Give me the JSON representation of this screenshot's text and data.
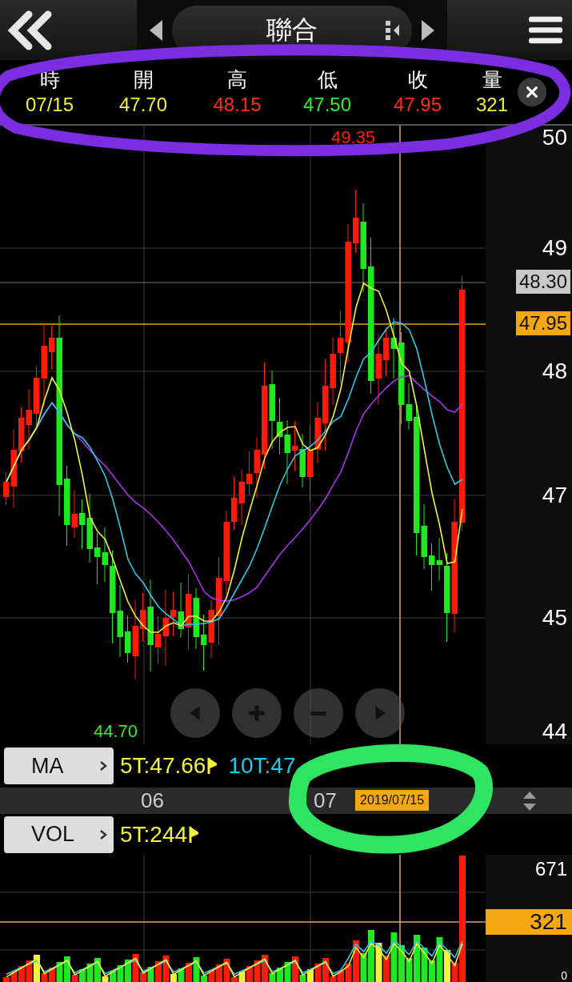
{
  "title": "聯合",
  "quote": [
    {
      "label": "時",
      "value": "07/15",
      "color": "#f2f23a"
    },
    {
      "label": "開",
      "value": "47.70",
      "color": "#f2f23a"
    },
    {
      "label": "高",
      "value": "48.15",
      "color": "#ff2a1a"
    },
    {
      "label": "低",
      "value": "47.50",
      "color": "#2bf02b"
    },
    {
      "label": "收",
      "value": "47.95",
      "color": "#ff2a1a"
    },
    {
      "label": "量",
      "value": "321",
      "color": "#f2f23a"
    }
  ],
  "price_axis": [
    "50",
    "49",
    "48",
    "47",
    "45",
    "44"
  ],
  "price_tags": [
    {
      "text": "48.30",
      "kind": "reference"
    },
    {
      "text": "47.95",
      "kind": "current"
    }
  ],
  "high_mark": "49.35",
  "low_mark": "44.70",
  "ma": {
    "button": "MA",
    "legend": [
      {
        "text": "5T:47.66",
        "color": "#f2f23a",
        "kind": "flagged"
      },
      {
        "text": "10T:47",
        "color": "#22c8e8",
        "kind": "plain"
      }
    ]
  },
  "date_axis": {
    "labels": [
      "06",
      "07"
    ],
    "cursor_date": "2019/07/15"
  },
  "vol": {
    "button": "VOL",
    "legend": [
      {
        "text": "5T:244",
        "color": "#f2f23a",
        "kind": "flagged"
      }
    ]
  },
  "volume_axis": {
    "max": "671",
    "current": "321",
    "min": "0"
  }
}
